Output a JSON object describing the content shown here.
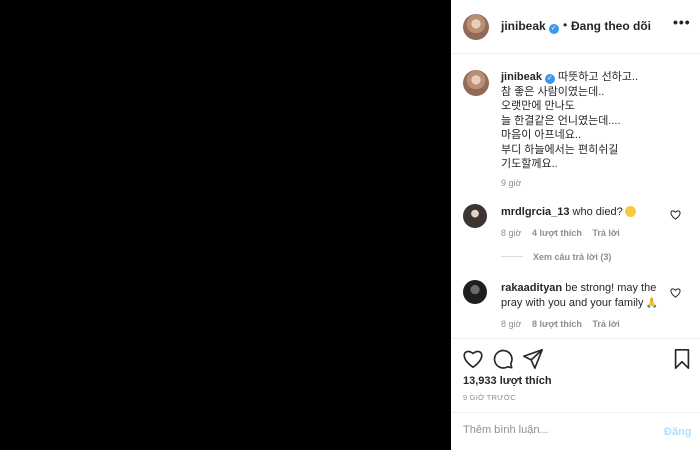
{
  "header": {
    "username": "jinibeak",
    "separator": "•",
    "follow_label": "Đang theo dõi",
    "more": "•••"
  },
  "caption": {
    "username": "jinibeak",
    "text": "따뜻하고 선하고..\n참 좋은 사람이였는데..\n오랫만에 만나도\n늘 한결같은 언니였는데....\n마음이 아프네요..\n부디 하늘에서는 편히쉬길\n기도할께요..",
    "time": "9 giờ"
  },
  "comments": [
    {
      "username": "mrdlgrcia_13",
      "text": "who died?",
      "emoji": "crying-face-icon",
      "time": "8 giờ",
      "likes": "4 lượt thích",
      "reply": "Trả lời",
      "view_replies": "Xem câu trả lời (3)"
    },
    {
      "username": "rakaadityan",
      "text": "be strong! may the pray with you and your family",
      "emoji": "praying-hands-icon",
      "time": "8 giờ",
      "likes": "8 lượt thích",
      "reply": "Trả lời"
    }
  ],
  "actions": {
    "likes": "13,933 lượt thích",
    "posted": "9 GIỜ TRƯỚC"
  },
  "comment_box": {
    "placeholder": "Thêm bình luận...",
    "post_label": "Đăng"
  },
  "colors": {
    "verified": "#3897f0",
    "post_disabled": "#b2dffc",
    "muted": "#8e8e8e"
  }
}
